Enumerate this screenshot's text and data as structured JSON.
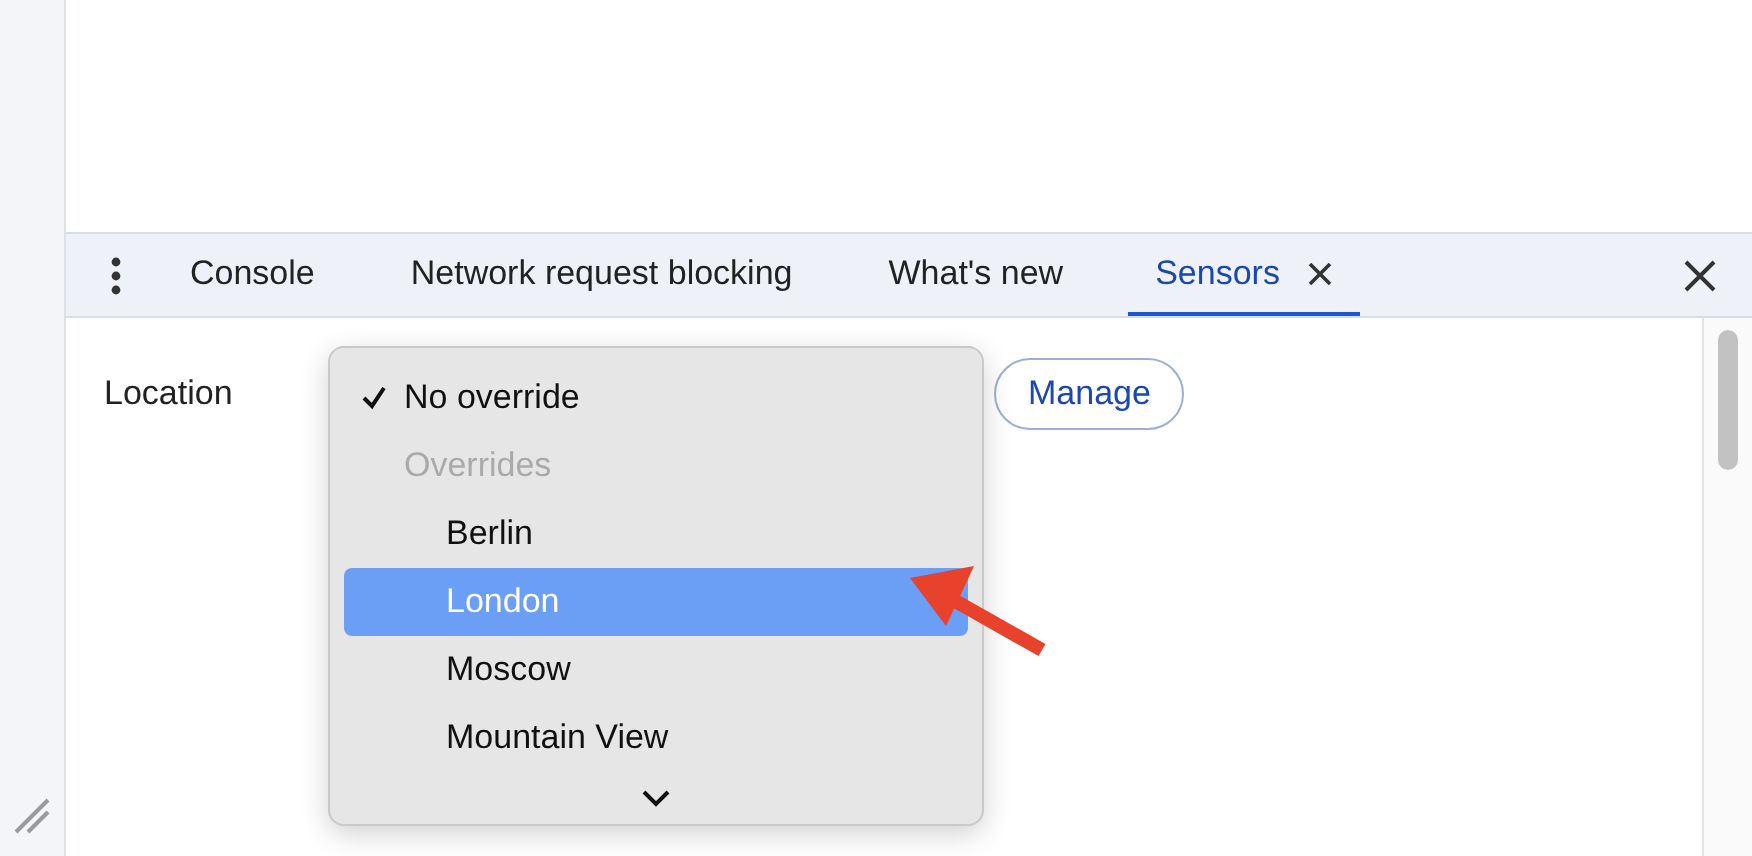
{
  "tabs": [
    {
      "label": "Console",
      "selected": false,
      "closable": false
    },
    {
      "label": "Network request blocking",
      "selected": false,
      "closable": false
    },
    {
      "label": "What's new",
      "selected": false,
      "closable": false
    },
    {
      "label": "Sensors",
      "selected": true,
      "closable": true
    }
  ],
  "location": {
    "label": "Location",
    "manage_button": "Manage"
  },
  "dropdown": {
    "items": [
      {
        "kind": "option",
        "label": "No override",
        "checked": true,
        "selected": false
      },
      {
        "kind": "group",
        "label": "Overrides",
        "children": [
          {
            "kind": "option",
            "label": "Berlin",
            "checked": false,
            "selected": false
          },
          {
            "kind": "option",
            "label": "London",
            "checked": false,
            "selected": true
          },
          {
            "kind": "option",
            "label": "Moscow",
            "checked": false,
            "selected": false
          },
          {
            "kind": "option",
            "label": "Mountain View",
            "checked": false,
            "selected": false
          }
        ]
      }
    ]
  }
}
